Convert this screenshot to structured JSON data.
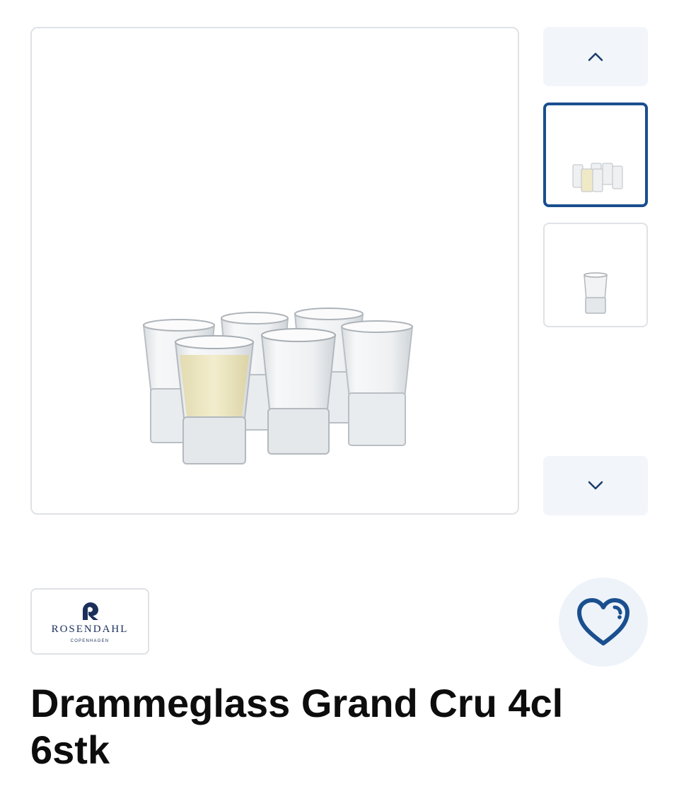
{
  "gallery": {
    "main_image_icon": "shot-glasses-set-photo",
    "up_icon": "chevron-up-icon",
    "down_icon": "chevron-down-icon",
    "thumbnails": [
      {
        "icon": "shot-glasses-set-thumbnail",
        "selected": true
      },
      {
        "icon": "single-shot-glass-thumbnail",
        "selected": false
      }
    ]
  },
  "brand": {
    "name": "ROSENDAHL",
    "subtitle": "COPENHAGEN",
    "icon": "rosendahl-logo-icon"
  },
  "favorite": {
    "icon": "heart-icon"
  },
  "product": {
    "title": "Drammeglass Grand Cru 4cl 6stk"
  },
  "colors": {
    "accent": "#1a4f8f",
    "border": "#dfe2e6",
    "button_bg": "#f2f5f9",
    "brand_navy": "#1b2f5a"
  }
}
